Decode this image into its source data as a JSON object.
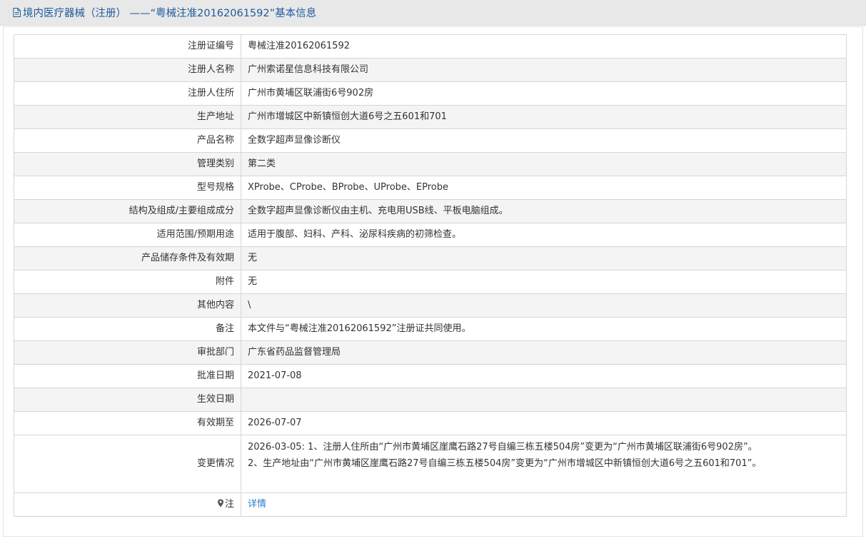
{
  "header": {
    "title": "境内医疗器械（注册） ——“粤械注准20162061592”基本信息"
  },
  "rows": [
    {
      "label": "注册证编号",
      "value": "粤械注准20162061592"
    },
    {
      "label": "注册人名称",
      "value": "广州索诺星信息科技有限公司"
    },
    {
      "label": "注册人住所",
      "value": "广州市黄埔区联浦街6号902房"
    },
    {
      "label": "生产地址",
      "value": "广州市增城区中新镇恒创大道6号之五601和701"
    },
    {
      "label": "产品名称",
      "value": "全数字超声显像诊断仪"
    },
    {
      "label": "管理类别",
      "value": "第二类"
    },
    {
      "label": "型号规格",
      "value": "XProbe、CProbe、BProbe、UProbe、EProbe"
    },
    {
      "label": "结构及组成/主要组成成分",
      "value": "全数字超声显像诊断仪由主机、充电用USB线、平板电脑组成。"
    },
    {
      "label": "适用范围/预期用途",
      "value": "适用于腹部、妇科、产科、泌尿科疾病的初筛检查。"
    },
    {
      "label": "产品储存条件及有效期",
      "value": "无"
    },
    {
      "label": "附件",
      "value": "无"
    },
    {
      "label": "其他内容",
      "value": "\\"
    },
    {
      "label": "备注",
      "value": "本文件与“粤械注准20162061592”注册证共同使用。"
    },
    {
      "label": "审批部门",
      "value": "广东省药品监督管理局"
    },
    {
      "label": "批准日期",
      "value": "2021-07-08"
    },
    {
      "label": "生效日期",
      "value": ""
    },
    {
      "label": "有效期至",
      "value": "2026-07-07"
    }
  ],
  "change": {
    "label": "变更情况",
    "lines": [
      "2026-03-05: 1、注册人住所由“广州市黄埔区崖鹰石路27号自编三栋五楼504房”变更为“广州市黄埔区联浦街6号902房”。",
      "2、生产地址由“广州市黄埔区崖鹰石路27号自编三栋五楼504房”变更为“广州市增城区中新镇恒创大道6号之五601和701”。"
    ]
  },
  "note": {
    "label": "注",
    "link_text": "详情",
    "icon": "map-pin-icon"
  },
  "colors": {
    "title": "#1e5a9c",
    "link": "#2b7ac9",
    "header_bg": "#e8e8e8",
    "alt_row_bg": "#f4f4f4",
    "border": "#d6d6d6"
  }
}
